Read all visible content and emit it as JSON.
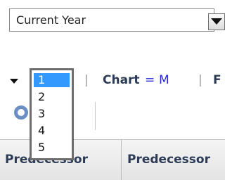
{
  "period_select": {
    "value": "Current Year"
  },
  "toolbar": {
    "chart_label": "Chart",
    "chart_eq": "=",
    "chart_value": "M",
    "next_label": "F",
    "separator": "|"
  },
  "page_dropdown": {
    "options": [
      "1",
      "2",
      "3",
      "4",
      "5"
    ],
    "selected": "1"
  },
  "grid": {
    "columns": [
      "Predecessor",
      "Predecessor"
    ]
  },
  "icons": [
    "gear-icon",
    "bar-chart-icon",
    "dropdown-arrow-icon",
    "collapse-caret-icon"
  ]
}
